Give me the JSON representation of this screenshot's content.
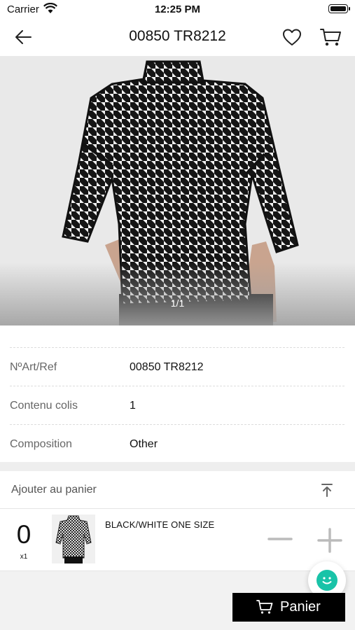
{
  "status_bar": {
    "carrier": "Carrier",
    "time": "12:25 PM"
  },
  "nav": {
    "title": "00850 TR8212",
    "icons": [
      "back-arrow-icon",
      "heart-icon",
      "cart-icon"
    ]
  },
  "gallery": {
    "counter": "1/1"
  },
  "details": [
    {
      "label": "NºArt/Ref",
      "value": "00850 TR8212"
    },
    {
      "label": "Contenu colis",
      "value": "1"
    },
    {
      "label": "Composition",
      "value": "Other"
    }
  ],
  "add_to_cart": {
    "title": "Ajouter au panier",
    "variant": {
      "quantity": "0",
      "multiplier": "x1",
      "name": "BLACK/WHITE ONE SIZE"
    }
  },
  "footer": {
    "cart_label": "Panier"
  },
  "colors": {
    "accent": "#000000",
    "chat": "#19c3a8",
    "divider": "#eeeeee"
  }
}
